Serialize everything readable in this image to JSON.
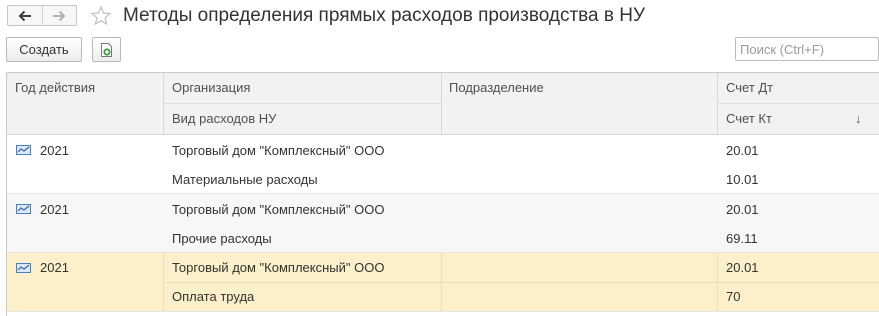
{
  "window": {
    "title": "Методы определения прямых расходов производства в НУ"
  },
  "toolbar": {
    "create_label": "Создать",
    "search_placeholder": "Поиск (Ctrl+F)",
    "search_value": ""
  },
  "table": {
    "headers": {
      "year": "Год действия",
      "organization": "Организация",
      "expense_type": "Вид расходов НУ",
      "department": "Подразделение",
      "debit_account": "Счет Дт",
      "credit_account": "Счет Кт",
      "sort_indicator": "↓"
    },
    "rows": [
      {
        "year": "2021",
        "organization": "Торговый дом \"Комплексный\" ООО",
        "expense_type": "Материальные расходы",
        "department": "",
        "debit_account": "20.01",
        "credit_account": "10.01"
      },
      {
        "year": "2021",
        "organization": "Торговый дом \"Комплексный\" ООО",
        "expense_type": "Прочие расходы",
        "department": "",
        "debit_account": "20.01",
        "credit_account": "69.11"
      },
      {
        "year": "2021",
        "organization": "Торговый дом \"Комплексный\" ООО",
        "expense_type": "Оплата труда",
        "department": "",
        "debit_account": "20.01",
        "credit_account": "70"
      }
    ]
  },
  "colors": {
    "selected_row": "#fbf0c9",
    "header_bg": "#f2f2f2",
    "copy_icon_green": "#3aa23a"
  },
  "icons": {
    "back": "arrow-left-icon",
    "forward": "arrow-right-icon",
    "favorite": "star-icon",
    "copy": "copy-document-icon",
    "row": "record-icon"
  }
}
